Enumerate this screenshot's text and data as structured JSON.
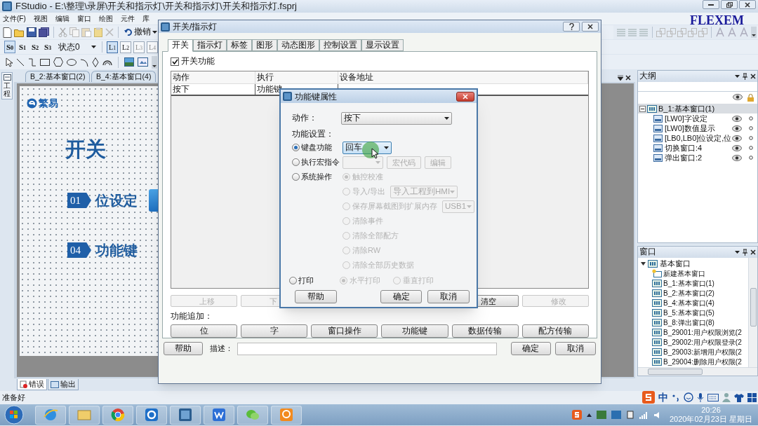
{
  "app": {
    "title": "FStudio - E:\\整理\\录屏\\开关和指示灯\\开关和指示灯\\开关和指示灯.fsprj",
    "menu": [
      "文件(F)",
      "视图",
      "编辑",
      "窗口",
      "绘图",
      "元件",
      "库"
    ],
    "brand": "FLEXEM"
  },
  "toolbar": {
    "undo": "撤销",
    "states": [
      {
        "label": "S$_{0}$",
        "selected": true
      },
      {
        "label": "S$_{1}$",
        "selected": false
      },
      {
        "label": "S$_{2}$",
        "selected": false
      },
      {
        "label": "S$_{3}$",
        "selected": false
      }
    ],
    "state_select": "状态0",
    "layers": [
      {
        "label": "L$_{1}$",
        "selected": true,
        "disabled": false
      },
      {
        "label": "L$_{2}$",
        "selected": false,
        "disabled": false
      },
      {
        "label": "L$_{3}$",
        "selected": false,
        "disabled": true
      },
      {
        "label": "L$_{4}$",
        "selected": false,
        "disabled": true
      }
    ]
  },
  "side_tab": "工程",
  "doc_tabs": [
    {
      "label": "B_2:基本窗口(2)",
      "selected": false
    },
    {
      "label": "B_4:基本窗口(4)",
      "selected": false
    }
  ],
  "canvas": {
    "logo": "繁易",
    "heading": "开关",
    "items": [
      {
        "number": "01",
        "label": "位设定"
      },
      {
        "number": "04",
        "label": "功能键"
      }
    ]
  },
  "bottom_tabs": [
    {
      "label": "错误",
      "selected": true
    },
    {
      "label": "输出",
      "selected": false
    }
  ],
  "status": "准备好",
  "outline": {
    "title": "大纲",
    "tree": [
      {
        "label": "B_1:基本窗口(1)",
        "expanded": true,
        "selected": true,
        "children": [
          {
            "label": "[LW0]字设定",
            "selected": false
          },
          {
            "label": "[LW0]数值显示",
            "selected": false
          },
          {
            "label": "[LB0,LB0]位设定,位",
            "selected": false
          },
          {
            "label": "切换窗口:4",
            "selected": false
          },
          {
            "label": "弹出窗口:2",
            "selected": false
          }
        ]
      }
    ]
  },
  "windows": {
    "title": "窗口",
    "tree": [
      {
        "label": "基本窗口",
        "expanded": true,
        "children": [
          {
            "label": "新建基本窗口",
            "kind": "new"
          },
          {
            "label": "B_1:基本窗口(1)",
            "kind": "window"
          },
          {
            "label": "B_2:基本窗口(2)",
            "kind": "window"
          },
          {
            "label": "B_4:基本窗口(4)",
            "kind": "window"
          },
          {
            "label": "B_5:基本窗口(5)",
            "kind": "window"
          },
          {
            "label": "B_8:弹出窗口(8)",
            "kind": "window"
          },
          {
            "label": "B_29001:用户权限浏览(2",
            "kind": "window"
          },
          {
            "label": "B_29002:用户权限登录(2",
            "kind": "window"
          },
          {
            "label": "B_29003:新增用户权限(2",
            "kind": "window"
          },
          {
            "label": "B_29004:删除用户权限(2",
            "kind": "window"
          }
        ]
      }
    ]
  },
  "dialog": {
    "title": "开关/指示灯",
    "tabs": [
      {
        "label": "开关",
        "selected": true
      },
      {
        "label": "指示灯",
        "selected": false
      },
      {
        "label": "标签",
        "selected": false
      },
      {
        "label": "图形",
        "selected": false
      },
      {
        "label": "动态图形",
        "selected": false
      },
      {
        "label": "控制设置",
        "selected": false
      },
      {
        "label": "显示设置",
        "selected": false
      }
    ],
    "switch_function": {
      "label": "开关功能",
      "checked": true
    },
    "table": {
      "columns": [
        "动作",
        "执行",
        "设备地址"
      ],
      "rows": [
        [
          "按下",
          "功能键"
        ]
      ]
    },
    "list_buttons": [
      {
        "label": "上移",
        "disabled": true
      },
      {
        "label": "下",
        "disabled": true
      },
      {
        "label": "清空",
        "disabled": false
      },
      {
        "label": "修改",
        "disabled": true
      }
    ],
    "add_label": "功能追加：",
    "add_buttons": [
      "位",
      "字",
      "窗口操作",
      "功能键",
      "数据传输",
      "配方传输"
    ],
    "help": "帮助",
    "desc_label": "描述：",
    "ok": "确定",
    "cancel": "取消"
  },
  "key_dialog": {
    "title": "功能键属性",
    "action_label": "动作：",
    "action_value": "按下",
    "settings_label": "功能设置：",
    "options": [
      {
        "kind": "keyboard",
        "label": "键盘功能",
        "selected": true,
        "value": "回车"
      },
      {
        "kind": "macro",
        "label": "执行宏指令",
        "selected": false,
        "buttons": [
          "宏代码",
          "编辑"
        ]
      },
      {
        "kind": "system",
        "label": "系统操作",
        "selected": false,
        "suboptions": [
          {
            "label": "触控校准",
            "selected": true,
            "disabled": true
          },
          {
            "label": "导入/导出",
            "selected": false,
            "disabled": true,
            "select": "导入工程到HMI"
          },
          {
            "label": "保存屏幕截图到扩展内存",
            "selected": false,
            "disabled": true,
            "select": "USB1"
          },
          {
            "label": "清除事件",
            "selected": false,
            "disabled": true
          },
          {
            "label": "清除全部配方",
            "selected": false,
            "disabled": true
          },
          {
            "label": "清除RW",
            "selected": false,
            "disabled": true
          },
          {
            "label": "清除全部历史数据",
            "selected": false,
            "disabled": true
          }
        ]
      },
      {
        "kind": "print",
        "label": "打印",
        "selected": false,
        "suboptions": [
          {
            "label": "水平打印",
            "selected": true,
            "disabled": true
          },
          {
            "label": "垂直打印",
            "selected": false,
            "disabled": true
          }
        ]
      }
    ],
    "help": "帮助",
    "ok": "确定",
    "cancel": "取消"
  },
  "ime": {
    "mode": "中"
  },
  "taskbar": {
    "time": "20:26",
    "date": "2020年02月23日 星期日"
  }
}
